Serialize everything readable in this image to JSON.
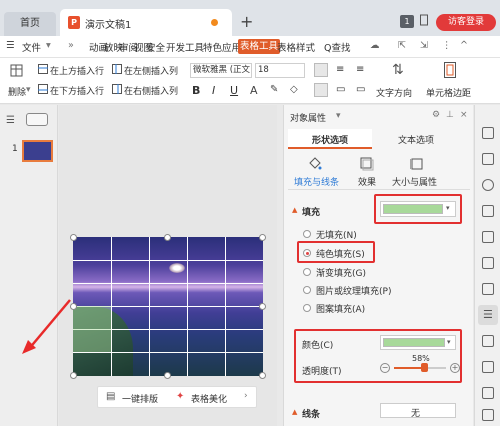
{
  "tabs": {
    "home": "首页",
    "document": "演示文稿1"
  },
  "window": {
    "badge": "1",
    "login": "访客登录"
  },
  "menu": {
    "file": "文件",
    "items": [
      "动画",
      "放映",
      "审阅",
      "视图",
      "安全",
      "开发工具",
      "特色应用",
      "表格工具",
      "表格样式"
    ],
    "search": "Q查找"
  },
  "ribbon": {
    "delete": "删除",
    "insert_above": "在上方插入行",
    "insert_below": "在下方插入行",
    "insert_left": "在左侧插入列",
    "insert_right": "在右侧插入列",
    "font_name": "微软雅黑 (正文",
    "font_size": "18",
    "bold": "B",
    "italic": "I",
    "underline": "U",
    "text_direction": "文字方向",
    "cell_margin": "单元格边距"
  },
  "thumbnail": {
    "number": "1"
  },
  "panel": {
    "title": "对象属性",
    "tab_shape": "形状选项",
    "tab_text": "文本选项",
    "sub_fill_line": "填充与线条",
    "sub_effect": "效果",
    "sub_size": "大小与属性",
    "fill_section": "填充",
    "fill_options": [
      "无填充(N)",
      "纯色填充(S)",
      "渐变填充(G)",
      "图片或纹理填充(P)",
      "图案填充(A)"
    ],
    "selected_fill": 1,
    "color_label": "颜色(C)",
    "transparency_label": "透明度(T)",
    "transparency_value": "58%",
    "line_section": "线条",
    "line_value": "无"
  },
  "floatbar": {
    "layout": "一键排版",
    "beautify": "表格美化"
  },
  "colors": {
    "accent": "#e05c2a",
    "fill_color": "#a8d99a",
    "highlight": "#e23030"
  }
}
